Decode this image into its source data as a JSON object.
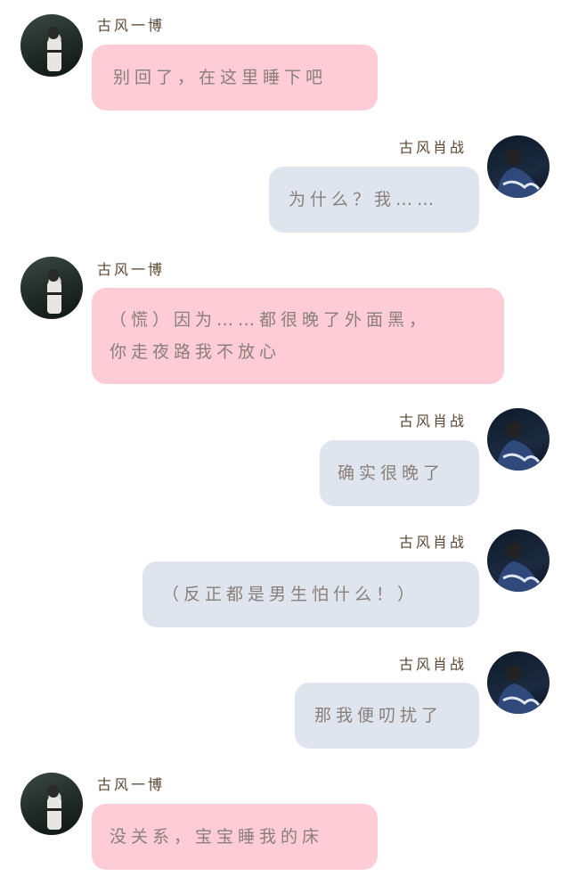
{
  "contacts": {
    "left_name": "古风一博",
    "right_name": "古风肖战"
  },
  "messages": [
    {
      "side": "left",
      "lines": [
        "别回了，在这里睡下吧"
      ]
    },
    {
      "side": "right",
      "lines": [
        "为什么？我……"
      ]
    },
    {
      "side": "left",
      "lines": [
        "（慌）因为……都很晚了外面黑，",
        "你走夜路我不放心"
      ]
    },
    {
      "side": "right",
      "lines": [
        "确实很晚了"
      ]
    },
    {
      "side": "right",
      "lines": [
        "（反正都是男生怕什么！）"
      ]
    },
    {
      "side": "right",
      "lines": [
        "那我便叨扰了"
      ]
    },
    {
      "side": "left",
      "lines": [
        "没关系，宝宝睡我的床"
      ]
    }
  ],
  "colors": {
    "left_bubble": "#fdccd6",
    "right_bubble": "#dfe5ee",
    "text": "#8a7f78",
    "name": "#5a4632"
  }
}
